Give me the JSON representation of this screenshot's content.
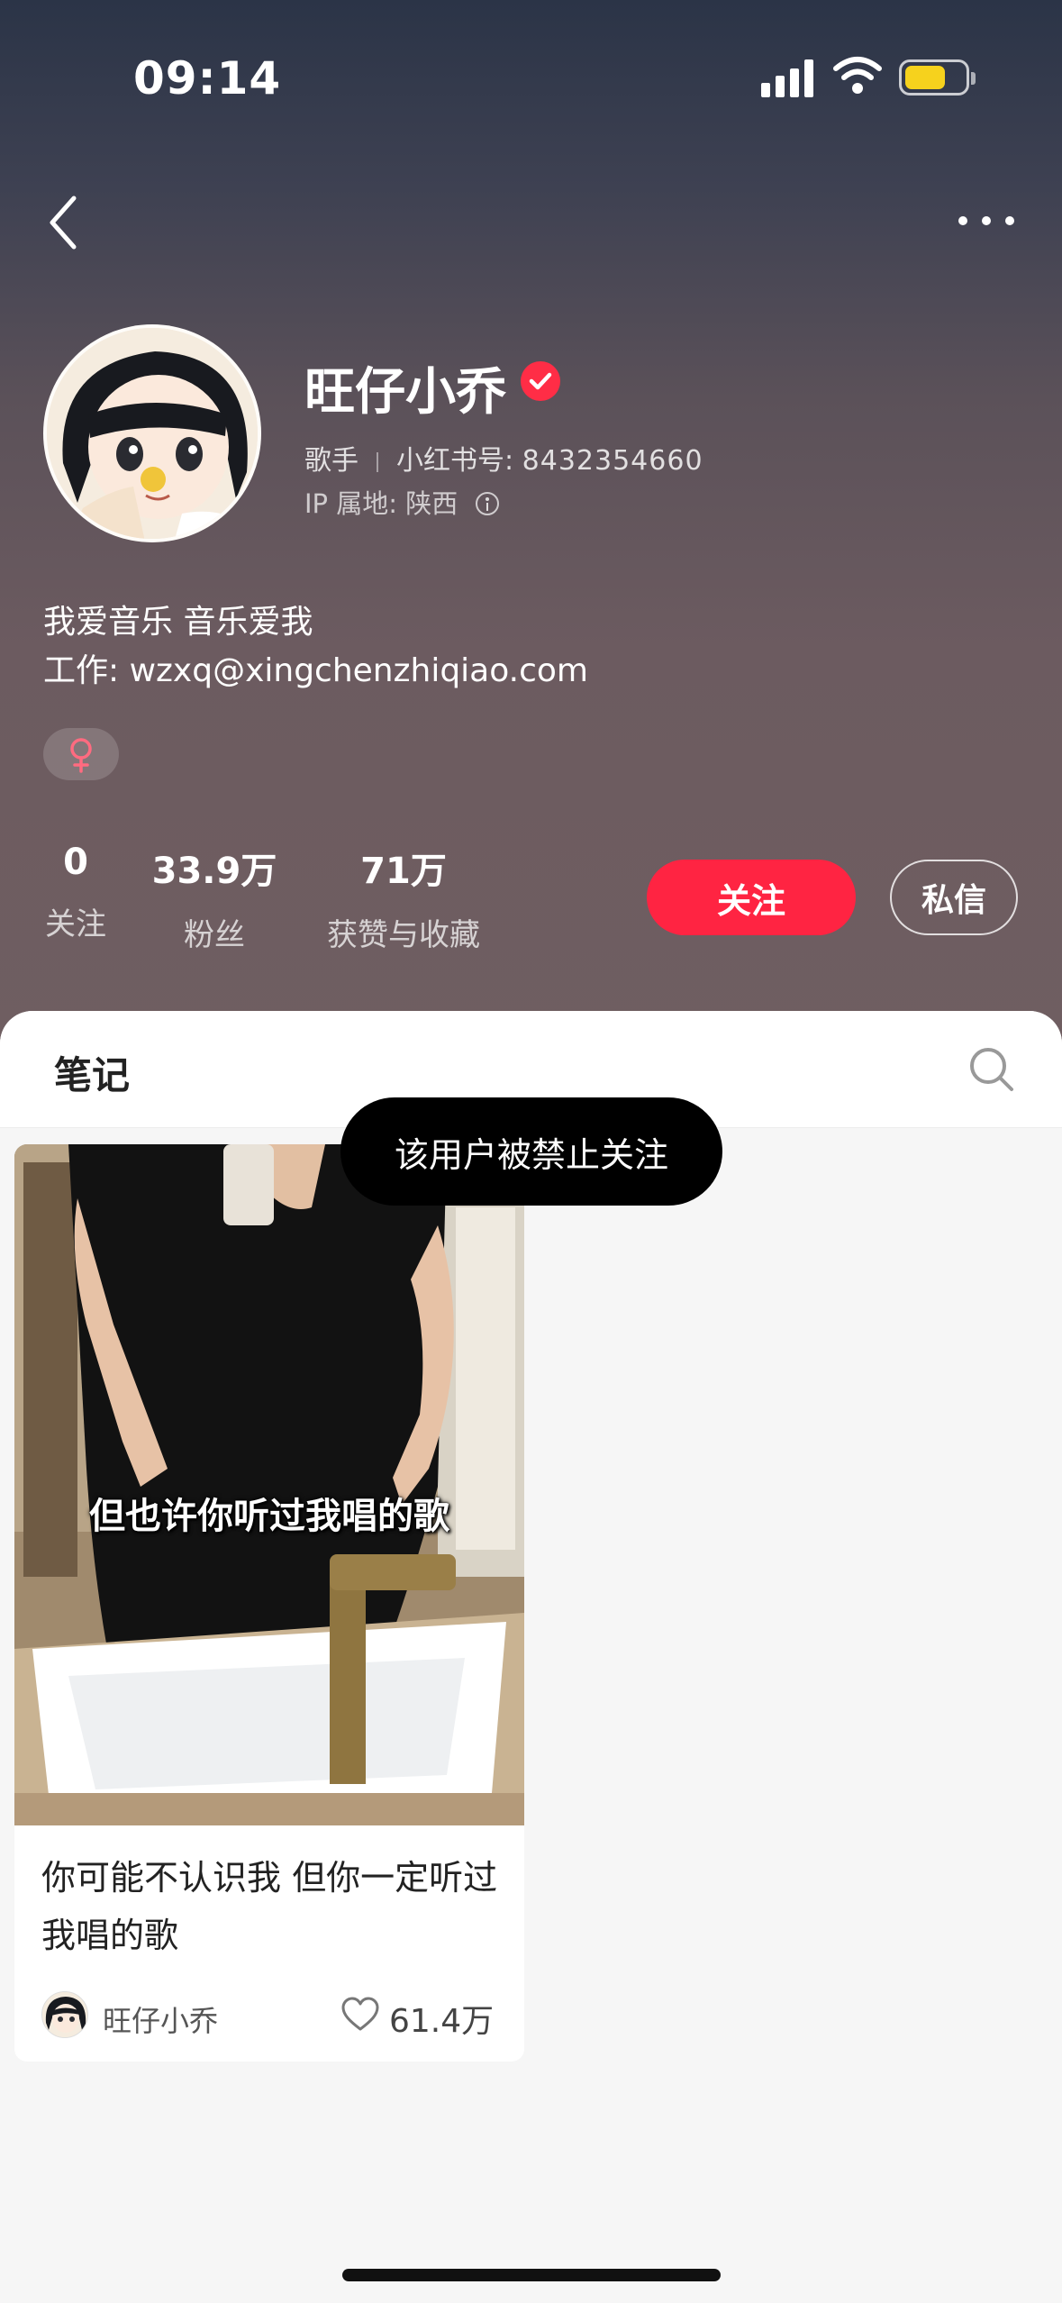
{
  "status_bar": {
    "time": "09:14"
  },
  "profile": {
    "name": "旺仔小乔",
    "role": "歌手",
    "id_label": "小红书号:",
    "id_value": "8432354660",
    "ip_label": "IP 属地: 陕西",
    "bio_line1": "我爱音乐 音乐爱我",
    "bio_line2": "工作: wzxq@xingchenzhiqiao.com",
    "gender_symbol": "♀"
  },
  "stats": [
    {
      "value": "0",
      "label": "关注"
    },
    {
      "value": "33.9万",
      "label": "粉丝"
    },
    {
      "value": "71万",
      "label": "获赞与收藏"
    }
  ],
  "actions": {
    "follow_label": "关注",
    "message_label": "私信"
  },
  "tabs": {
    "notes_label": "笔记"
  },
  "toast": {
    "text": "该用户被禁止关注"
  },
  "notes": [
    {
      "image_caption": "但也许你听过我唱的歌",
      "title": "你可能不认识我 但你一定听过我唱的歌",
      "author": "旺仔小乔",
      "likes": "61.4万"
    }
  ],
  "colors": {
    "accent": "#ff2442",
    "verified": "#ff2d46",
    "battery": "#f6d21d"
  },
  "icons": [
    "back-icon",
    "more-icon",
    "verified-icon",
    "info-icon",
    "female-icon",
    "search-icon",
    "heart-icon"
  ]
}
